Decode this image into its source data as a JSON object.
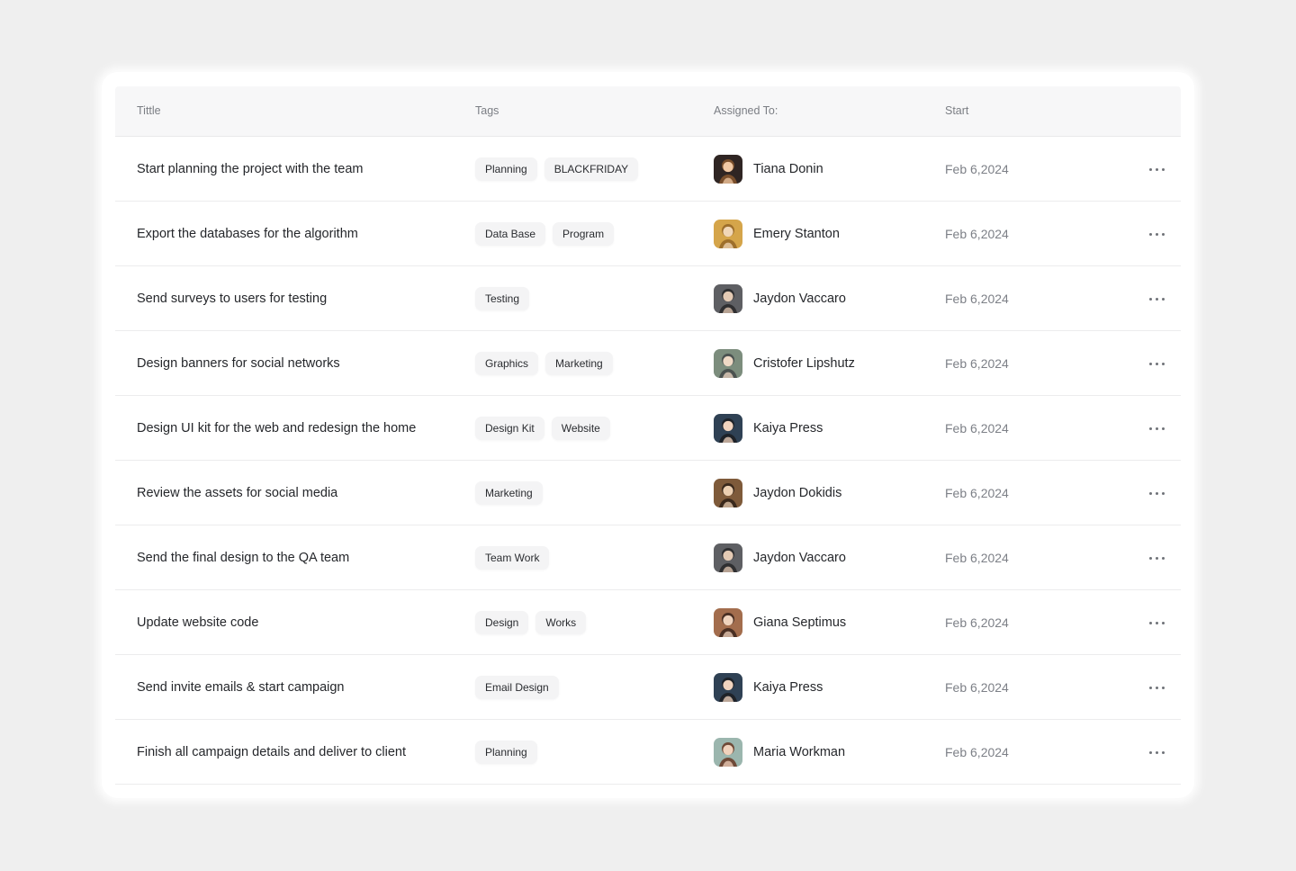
{
  "table": {
    "headers": {
      "title": "Tittle",
      "tags": "Tags",
      "assigned": "Assigned To:",
      "start": "Start"
    },
    "rows": [
      {
        "title": "Start planning the project with the team",
        "tags": [
          "Planning",
          "BLACKFRIDAY"
        ],
        "assignee": "Tiana Donin",
        "start": "Feb 6,2024",
        "avatar_colors": [
          "#2f2523",
          "#f0c8a4",
          "#7a4f2c"
        ]
      },
      {
        "title": "Export the databases for the algorithm",
        "tags": [
          "Data Base",
          "Program"
        ],
        "assignee": "Emery Stanton",
        "start": "Feb 6,2024",
        "avatar_colors": [
          "#d5a54a",
          "#f1d7b7",
          "#9e6f2b"
        ]
      },
      {
        "title": "Send surveys to users for testing",
        "tags": [
          "Testing"
        ],
        "assignee": "Jaydon Vaccaro",
        "start": "Feb 6,2024",
        "avatar_colors": [
          "#5e5f63",
          "#e4cab4",
          "#2f2f31"
        ]
      },
      {
        "title": "Design banners for social networks",
        "tags": [
          "Graphics",
          "Marketing"
        ],
        "assignee": "Cristofer Lipshutz",
        "start": "Feb 6,2024",
        "avatar_colors": [
          "#7c8d7d",
          "#efd9c5",
          "#4b5250"
        ]
      },
      {
        "title": "Design UI kit for the web and redesign the home",
        "tags": [
          "Design Kit",
          "Website"
        ],
        "assignee": "Kaiya Press",
        "start": "Feb 6,2024",
        "avatar_colors": [
          "#2f4154",
          "#f1d4bf",
          "#1e2228"
        ]
      },
      {
        "title": "Review the assets for social media",
        "tags": [
          "Marketing"
        ],
        "assignee": "Jaydon Dokidis",
        "start": "Feb 6,2024",
        "avatar_colors": [
          "#7e5a3a",
          "#eccfb1",
          "#3a291c"
        ]
      },
      {
        "title": "Send the final design to the QA team",
        "tags": [
          "Team Work"
        ],
        "assignee": "Jaydon Vaccaro",
        "start": "Feb 6,2024",
        "avatar_colors": [
          "#5e5f63",
          "#e4cab4",
          "#2f2f31"
        ]
      },
      {
        "title": "Update website code",
        "tags": [
          "Design",
          "Works"
        ],
        "assignee": "Giana Septimus",
        "start": "Feb 6,2024",
        "avatar_colors": [
          "#a36d4d",
          "#f0d3bd",
          "#4a2f23"
        ]
      },
      {
        "title": "Send invite emails & start campaign",
        "tags": [
          "Email Design"
        ],
        "assignee": "Kaiya Press",
        "start": "Feb 6,2024",
        "avatar_colors": [
          "#2f4154",
          "#f1d4bf",
          "#1e2228"
        ]
      },
      {
        "title": "Finish all campaign details and deliver to client",
        "tags": [
          "Planning"
        ],
        "assignee": "Maria Workman",
        "start": "Feb 6,2024",
        "avatar_colors": [
          "#9bb6ae",
          "#f0d2bc",
          "#6f4a38"
        ]
      }
    ]
  }
}
